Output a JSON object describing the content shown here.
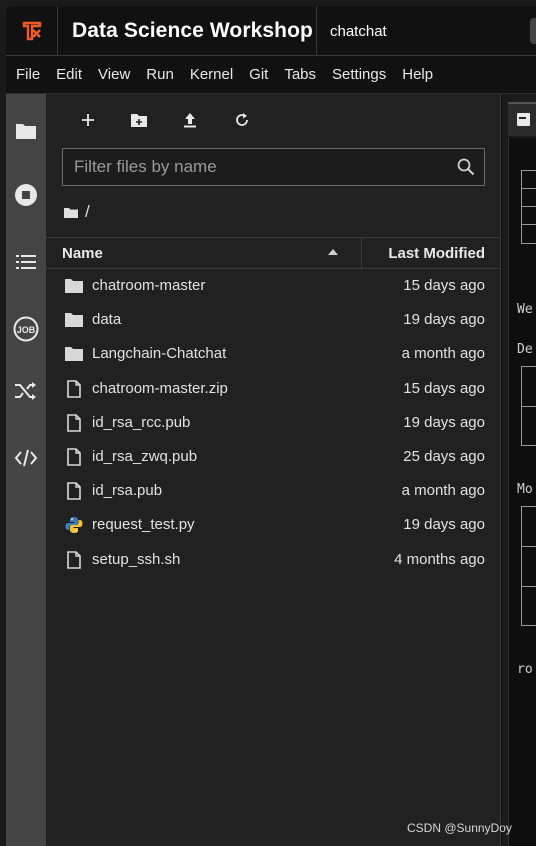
{
  "app": {
    "title": "Data Science Workshop",
    "workspace": "chatchat",
    "accent_color": "#f05a28"
  },
  "menu": [
    "File",
    "Edit",
    "View",
    "Run",
    "Kernel",
    "Git",
    "Tabs",
    "Settings",
    "Help"
  ],
  "activity_bar": {
    "icons": [
      "folder-icon",
      "stop-circle-icon",
      "list-icon",
      "job-icon",
      "shuffle-icon",
      "code-icon"
    ],
    "job_label": "JOB"
  },
  "file_browser": {
    "toolbar": [
      "new-launcher-icon",
      "new-folder-icon",
      "upload-icon",
      "refresh-icon"
    ],
    "filter_placeholder": "Filter files by name",
    "breadcrumb": "/",
    "columns": {
      "name": "Name",
      "modified": "Last Modified"
    },
    "files": [
      {
        "name": "chatroom-master",
        "modified": "15 days ago",
        "icon": "folder"
      },
      {
        "name": "data",
        "modified": "19 days ago",
        "icon": "folder"
      },
      {
        "name": "Langchain-Chatchat",
        "modified": "a month ago",
        "icon": "folder"
      },
      {
        "name": "chatroom-master.zip",
        "modified": "15 days ago",
        "icon": "file"
      },
      {
        "name": "id_rsa_rcc.pub",
        "modified": "19 days ago",
        "icon": "file"
      },
      {
        "name": "id_rsa_zwq.pub",
        "modified": "25 days ago",
        "icon": "file"
      },
      {
        "name": "id_rsa.pub",
        "modified": "a month ago",
        "icon": "file"
      },
      {
        "name": "request_test.py",
        "modified": "19 days ago",
        "icon": "python"
      },
      {
        "name": "setup_ssh.sh",
        "modified": "4 months ago",
        "icon": "file"
      }
    ]
  },
  "terminal_peek": {
    "lines": [
      "We",
      "De",
      "Mo",
      "ro"
    ]
  },
  "watermark": "CSDN @SunnyDoy"
}
